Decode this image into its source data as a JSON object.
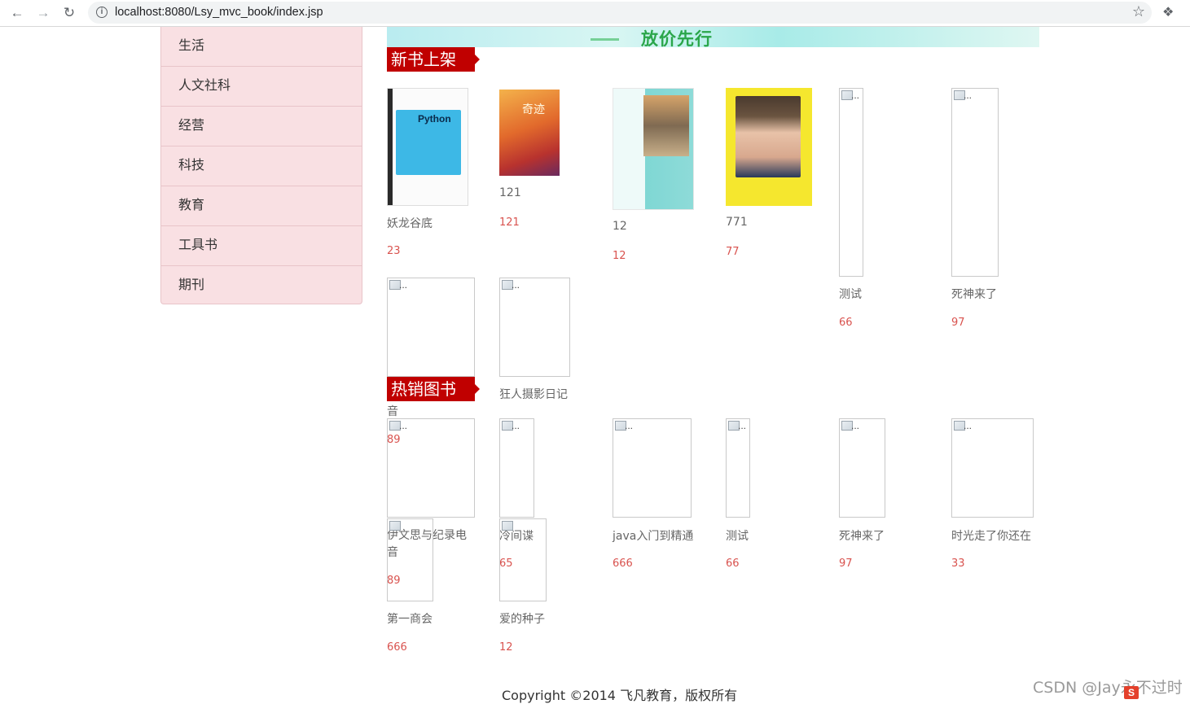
{
  "browser": {
    "url": "localhost:8080/Lsy_mvc_book/index.jsp"
  },
  "sidebar": {
    "items": [
      {
        "label": "生活"
      },
      {
        "label": "人文社科"
      },
      {
        "label": "经营"
      },
      {
        "label": "科技"
      },
      {
        "label": "教育"
      },
      {
        "label": "工具书"
      },
      {
        "label": "期刊"
      }
    ]
  },
  "banner": {
    "text": "放价先行"
  },
  "new_books": {
    "title": "新书上架",
    "items": [
      {
        "name": "妖龙谷底",
        "price": "23",
        "cover": "python-book-cover"
      },
      {
        "name": "121",
        "price": "121",
        "cover": "miracle-book-cover"
      },
      {
        "name": "12",
        "price": "12",
        "cover": "love-book-cover"
      },
      {
        "name": "771",
        "price": "77",
        "cover": "time-book-cover"
      },
      {
        "name": "测试",
        "price": "66",
        "cover": "broken"
      },
      {
        "name": "死神来了",
        "price": "97",
        "cover": "broken"
      },
      {
        "name": "伊文思与纪录电音",
        "price": "89",
        "cover": "broken"
      },
      {
        "name": "狂人摄影日记",
        "price": "",
        "cover": "broken"
      }
    ]
  },
  "hot_books": {
    "title": "热销图书",
    "items": [
      {
        "name": "伊文思与纪录电音",
        "price": "89"
      },
      {
        "name": "冷间谍",
        "price": "65"
      },
      {
        "name": "java入门到精通",
        "price": "666"
      },
      {
        "name": "测试",
        "price": "66"
      },
      {
        "name": "死神来了",
        "price": "97"
      },
      {
        "name": "时光走了你还在",
        "price": "33"
      },
      {
        "name": "第一商会",
        "price": "666"
      },
      {
        "name": "爱的种子",
        "price": "12"
      }
    ]
  },
  "broken_image_alt": "...",
  "footer": {
    "copyright": "Copyright ©2014 飞凡教育，版权所有"
  },
  "watermark": {
    "text": "CSDN @Jay永不过时"
  },
  "colors": {
    "ribbon": "#c00000",
    "price": "#d9534f",
    "sidebar_bg": "#f9e0e3"
  }
}
